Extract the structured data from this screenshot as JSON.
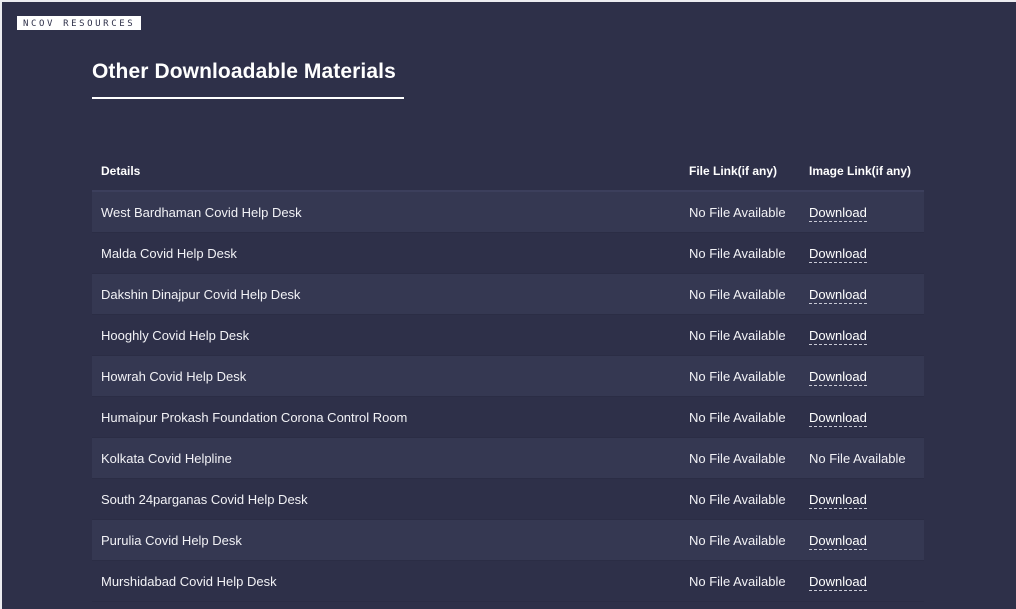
{
  "brand": {
    "label": "NCOV RESOURCES"
  },
  "section": {
    "title": "Other Downloadable Materials"
  },
  "table": {
    "headers": [
      "Details",
      "File Link(if any)",
      "Image Link(if any)"
    ],
    "rows": [
      {
        "details": "West Bardhaman Covid Help Desk",
        "file": "No File Available",
        "image": "Download",
        "image_is_link": true
      },
      {
        "details": "Malda Covid Help Desk",
        "file": "No File Available",
        "image": "Download",
        "image_is_link": true
      },
      {
        "details": "Dakshin Dinajpur Covid Help Desk",
        "file": "No File Available",
        "image": "Download",
        "image_is_link": true
      },
      {
        "details": "Hooghly Covid Help Desk",
        "file": "No File Available",
        "image": "Download",
        "image_is_link": true
      },
      {
        "details": "Howrah Covid Help Desk",
        "file": "No File Available",
        "image": "Download",
        "image_is_link": true
      },
      {
        "details": "Humaipur Prokash Foundation Corona Control Room",
        "file": "No File Available",
        "image": "Download",
        "image_is_link": true
      },
      {
        "details": "Kolkata Covid Helpline",
        "file": "No File Available",
        "image": "No File Available",
        "image_is_link": false
      },
      {
        "details": "South 24parganas Covid Help Desk",
        "file": "No File Available",
        "image": "Download",
        "image_is_link": true
      },
      {
        "details": "Purulia Covid Help Desk",
        "file": "No File Available",
        "image": "Download",
        "image_is_link": true
      },
      {
        "details": "Murshidabad Covid Help Desk",
        "file": "No File Available",
        "image": "Download",
        "image_is_link": true
      }
    ]
  },
  "colors": {
    "background": "#2e3049",
    "row_alt": "#353852",
    "text": "#ffffff"
  }
}
